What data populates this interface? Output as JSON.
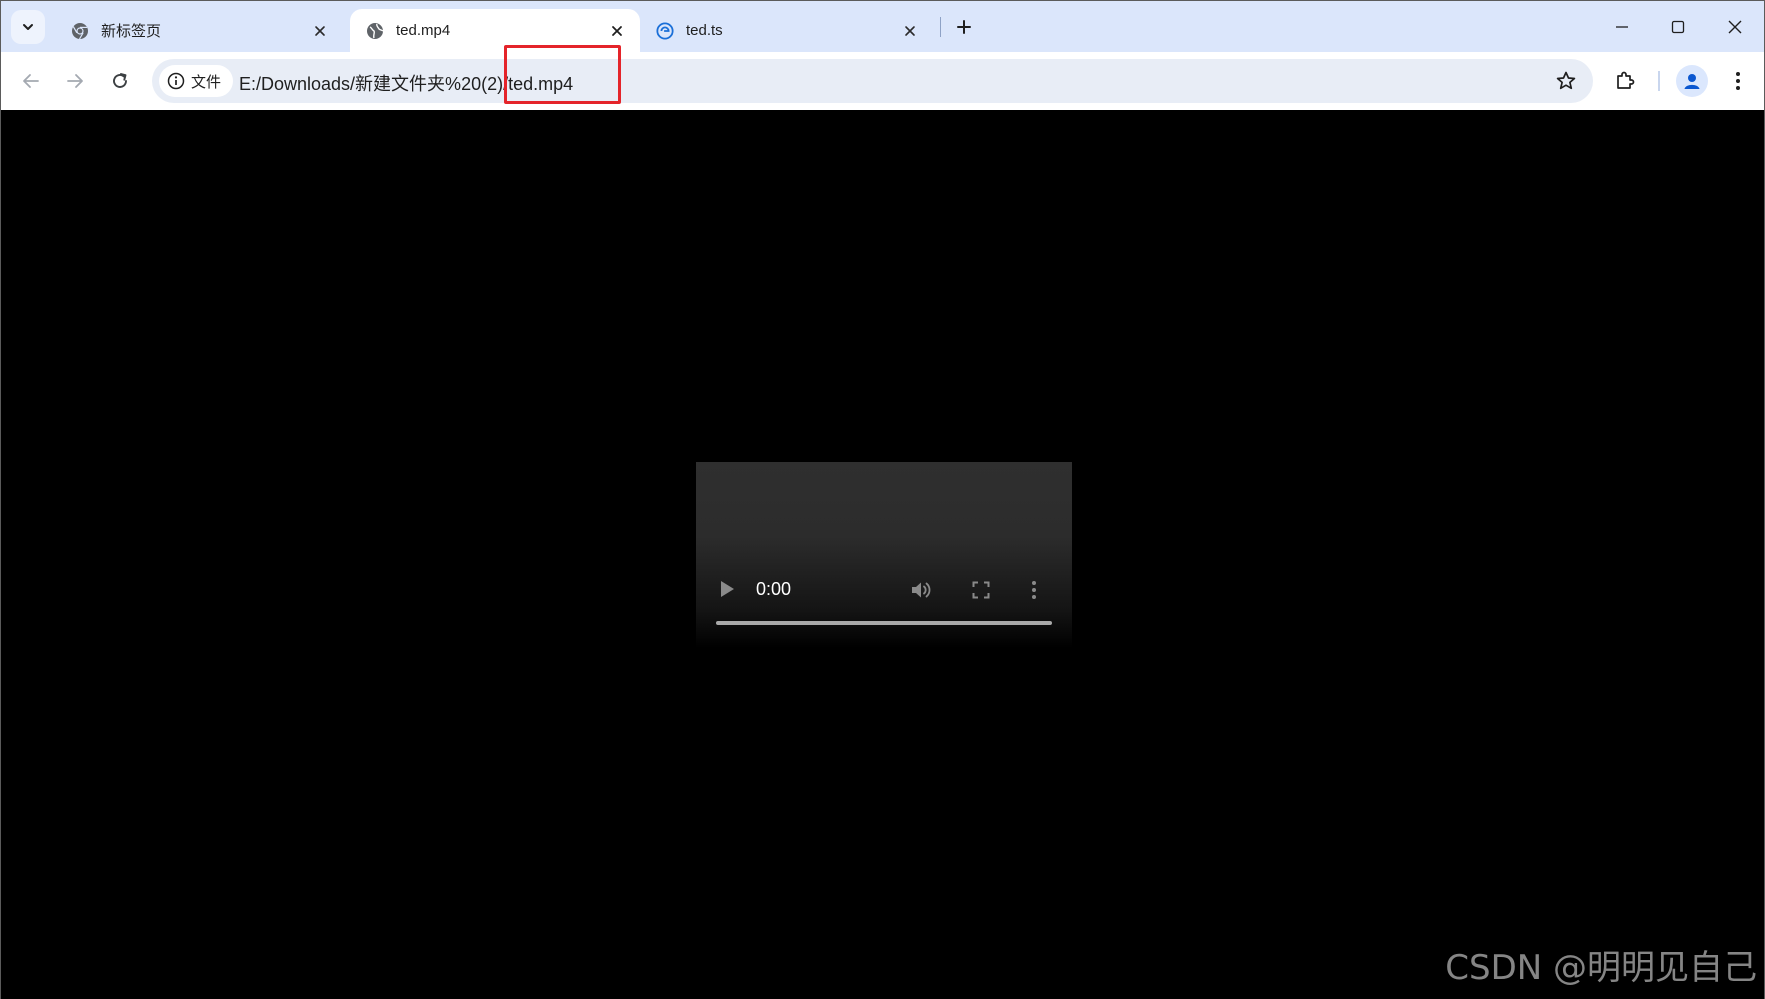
{
  "tabs": [
    {
      "title": "新标签页",
      "icon": "chrome-icon",
      "active": false
    },
    {
      "title": "ted.mp4",
      "icon": "globe-icon",
      "active": true
    },
    {
      "title": "ted.ts",
      "icon": "edge-icon",
      "active": false
    }
  ],
  "address_bar": {
    "security_chip": "文件",
    "url": "E:/Downloads/新建文件夹%20(2)/ted.mp4"
  },
  "video": {
    "time": "0:00",
    "progress": 0
  },
  "watermark": "CSDN @明明见自己",
  "colors": {
    "tabstrip": "#dbe6fb",
    "omnibox": "#e8edf6",
    "highlight": "#e4242a",
    "page_background": "#000000"
  }
}
